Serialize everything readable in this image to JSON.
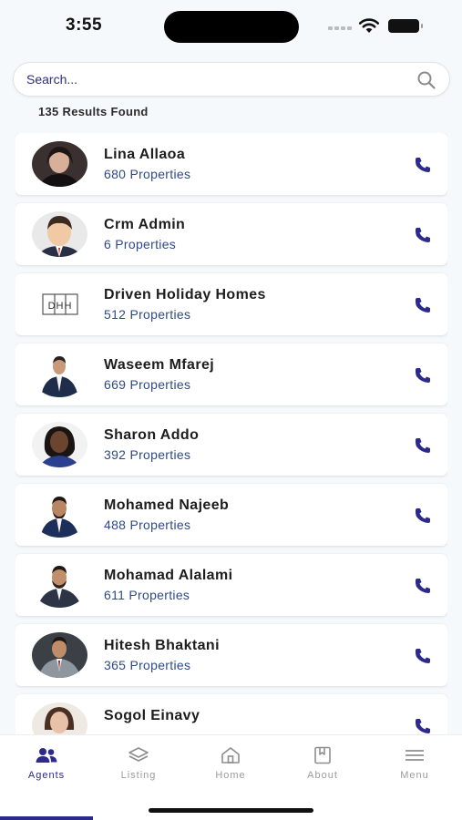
{
  "status_bar": {
    "time": "3:55"
  },
  "search": {
    "placeholder": "Search..."
  },
  "results": {
    "text": "135 Results Found"
  },
  "agents": [
    {
      "name": "Lina Allaoa",
      "properties": "680 Properties",
      "avatar": "photo"
    },
    {
      "name": "Crm Admin",
      "properties": "6 Properties",
      "avatar": "cartoon"
    },
    {
      "name": "Driven Holiday Homes",
      "properties": "512 Properties",
      "avatar": "logo"
    },
    {
      "name": "Waseem Mfarej",
      "properties": "669 Properties",
      "avatar": "photo"
    },
    {
      "name": "Sharon Addo",
      "properties": "392 Properties",
      "avatar": "photo"
    },
    {
      "name": "Mohamed Najeeb",
      "properties": "488 Properties",
      "avatar": "photo"
    },
    {
      "name": "Mohamad Alalami",
      "properties": "611 Properties",
      "avatar": "photo"
    },
    {
      "name": "Hitesh Bhaktani",
      "properties": "365 Properties",
      "avatar": "photo"
    },
    {
      "name": "Sogol Einavy",
      "properties": "",
      "avatar": "photo"
    }
  ],
  "logo_text": "DHH",
  "nav": {
    "items": [
      {
        "label": "Agents",
        "icon": "people-icon",
        "active": true
      },
      {
        "label": "Listing",
        "icon": "layers-icon",
        "active": false
      },
      {
        "label": "Home",
        "icon": "home-icon",
        "active": false
      },
      {
        "label": "About",
        "icon": "book-icon",
        "active": false
      },
      {
        "label": "Menu",
        "icon": "menu-icon",
        "active": false
      }
    ]
  },
  "colors": {
    "accent": "#2c2a8a",
    "properties_text": "#2e4a86",
    "background": "#f6f9fb"
  }
}
